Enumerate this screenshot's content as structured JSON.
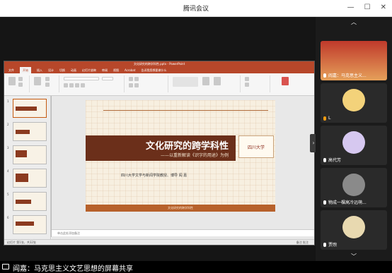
{
  "window": {
    "title": "腾讯会议"
  },
  "ppt": {
    "file_title": "文化研究的跨学科性.pptx - PowerPoint",
    "tabs": [
      "文件",
      "开始",
      "插入",
      "设计",
      "切换",
      "动画",
      "幻灯片放映",
      "审阅",
      "视图",
      "Acrobat",
      "告诉我您想要做什么"
    ],
    "active_tab": "开始",
    "slide_numbers": [
      "1",
      "2",
      "3",
      "4",
      "5",
      "6"
    ],
    "slide": {
      "title": "文化研究的跨学科性",
      "subtitle": "——以重新解读《识字的用途》为例",
      "author": "四川大学文学与新闻学院教授、博导   阎  嘉",
      "logo_text": "四川大学",
      "footer": "文化研究的跨学科性"
    },
    "notes_placeholder": "单击此处添加备注",
    "status_left": "幻灯片 第1张，共32张",
    "status_right": "备注   批注"
  },
  "participants": [
    {
      "name": "阎嘉：马克思主义...",
      "avatar_color": "#c0392b"
    },
    {
      "name": "L",
      "avatar_color": "#f3d27a"
    },
    {
      "name": "高代芳",
      "avatar_color": "#d6c8f0"
    },
    {
      "name": "物成一棵高冷远萌...",
      "avatar_color": "#8a8a8a"
    },
    {
      "name": "贾煦",
      "avatar_color": "#e8d9b0"
    }
  ],
  "share_banner": "阎嘉：马克思主义文艺思想的屏幕共享"
}
